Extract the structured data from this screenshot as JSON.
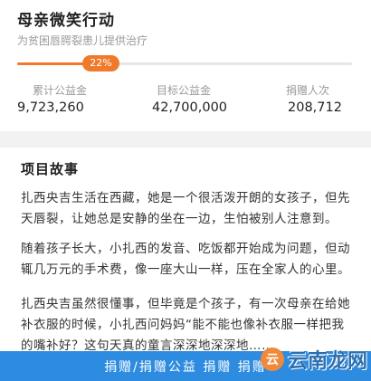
{
  "header": {
    "title": "母亲微笑行动",
    "subtitle": "为贫困唇腭裂患儿提供治疗"
  },
  "progress": {
    "percent_label": "22%",
    "fraction": 0.22,
    "accent_color": "#f07a2c"
  },
  "stats": [
    {
      "label": "累计公益金",
      "value": "9,723,260"
    },
    {
      "label": "目标公益金",
      "value": "42,700,000"
    },
    {
      "label": "捐赠人次",
      "value": "208,712"
    }
  ],
  "story": {
    "heading": "项目故事",
    "paragraphs": [
      "扎西央吉生活在西藏，她是一个很活泼开朗的女孩子，但先天唇裂，让她总是安静的坐在一边，生怕被别人注意到。",
      "随着孩子长大，小扎西的发音、吃饭都开始成为问题，但动辄几万元的手术费，像一座大山一样，压在全家人的心里。",
      "扎西央吉虽然很懂事，但毕竟是个孩子，有一次母亲在给她补衣服的时候，小扎西问妈妈“能不能也像补衣服一样把我的嘴补好？这句天真的童言深深地深深地……"
    ]
  },
  "donate": {
    "label": "捐赠/捐赠公益 捐赠 捐赠",
    "color": "#2d8ce0"
  },
  "watermark": {
    "text": "云南龙网"
  }
}
